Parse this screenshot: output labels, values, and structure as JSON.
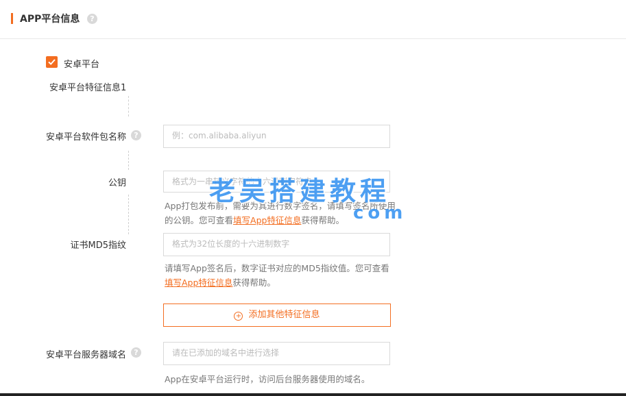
{
  "header": {
    "title": "APP平台信息",
    "help_glyph": "?"
  },
  "android": {
    "checkbox_label": "安卓平台",
    "section_title": "安卓平台特征信息1",
    "package": {
      "label": "安卓平台软件包名称",
      "placeholder": "例：com.alibaba.aliyun"
    },
    "public_key": {
      "label": "公钥",
      "placeholder": "格式为一串转义字符的十六进制字符串",
      "help_before": "App打包发布前，需要为其进行数字签名，请填写签名所使用的公钥。您可查看",
      "help_link": "填写App特征信息",
      "help_after": "获得帮助。"
    },
    "md5": {
      "label": "证书MD5指纹",
      "placeholder": "格式为32位长度的十六进制数字",
      "help_before": "请填写App签名后，数字证书对应的MD5指纹值。您可查看",
      "help_link": "填写App特征信息",
      "help_after": "获得帮助。"
    },
    "add_button": "添加其他特征信息",
    "server_domain": {
      "label": "安卓平台服务器域名",
      "placeholder": "请在已添加的域名中进行选择",
      "help": "App在安卓平台运行时，访问后台服务器使用的域名。"
    }
  },
  "watermark": {
    "main": "老吴搭建教程",
    "sub": "com"
  },
  "colors": {
    "accent": "#f36d20",
    "border": "#d9d9d9",
    "watermark": "#2e8ff0"
  }
}
